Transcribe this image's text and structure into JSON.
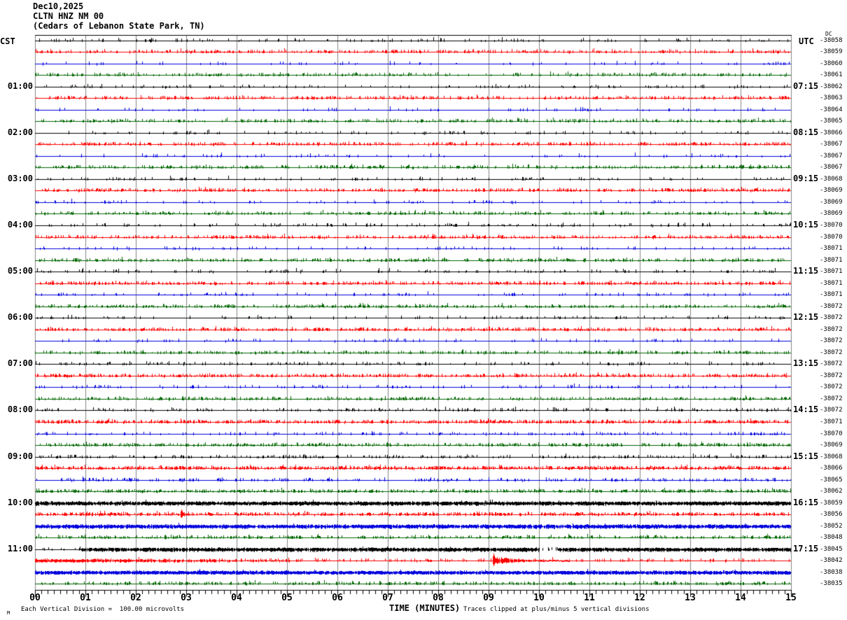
{
  "header": {
    "date": "Dec10,2025",
    "station": "CLTN HNZ NM 00",
    "location": "(Cedars of Lebanon State Park, TN)"
  },
  "left_axis": {
    "label": "CST"
  },
  "right_axis": {
    "label": "UTC",
    "dc_header": "DC"
  },
  "x_axis": {
    "label": "TIME (MINUTES)",
    "ticks": [
      "00",
      "01",
      "02",
      "03",
      "04",
      "05",
      "06",
      "07",
      "08",
      "09",
      "10",
      "11",
      "12",
      "13",
      "14",
      "15"
    ]
  },
  "footer": {
    "scale_note": "Each Vertical Division =  100.00 microvolts",
    "clip_note": "Traces clipped at plus/minus 5 vertical divisions",
    "corner_mark": "M"
  },
  "chart_data": {
    "type": "line",
    "subtype": "seismogram_helicorder",
    "title": "CLTN HNZ NM 00 (Cedars of Lebanon State Park, TN) Dec10,2025",
    "minutes_per_row": 15,
    "rows_total": 48,
    "grid": "vertical lines each minute",
    "left_hour_labels": [
      "01:00",
      "02:00",
      "03:00",
      "04:00",
      "05:00",
      "06:00",
      "07:00",
      "08:00",
      "09:00",
      "10:00",
      "11:00"
    ],
    "right_hour_labels": [
      "07:15",
      "08:15",
      "09:15",
      "10:15",
      "11:15",
      "12:15",
      "13:15",
      "14:15",
      "15:15",
      "16:15",
      "17:15"
    ],
    "colors": {
      "black": "#000000",
      "red": "#ff0000",
      "blue": "#0000dd",
      "green": "#006600",
      "grid": "#858585"
    },
    "rows": [
      {
        "cst": "00:00",
        "color": "black",
        "dc": "-38058",
        "noise": 0.1
      },
      {
        "cst": "00:15",
        "color": "red",
        "dc": "-38059",
        "noise": 0.3
      },
      {
        "cst": "00:30",
        "color": "blue",
        "dc": "-38060",
        "noise": 0.08
      },
      {
        "cst": "00:45",
        "color": "green",
        "dc": "-38061",
        "noise": 0.25
      },
      {
        "cst": "01:00",
        "color": "black",
        "dc": "-38062",
        "noise": 0.1
      },
      {
        "cst": "01:15",
        "color": "red",
        "dc": "-38063",
        "noise": 0.3
      },
      {
        "cst": "01:30",
        "color": "blue",
        "dc": "-38064",
        "noise": 0.08
      },
      {
        "cst": "01:45",
        "color": "green",
        "dc": "-38065",
        "noise": 0.26
      },
      {
        "cst": "02:00",
        "color": "black",
        "dc": "-38066",
        "noise": 0.1
      },
      {
        "cst": "02:15",
        "color": "red",
        "dc": "-38067",
        "noise": 0.3
      },
      {
        "cst": "02:30",
        "color": "blue",
        "dc": "-38067",
        "noise": 0.08
      },
      {
        "cst": "02:45",
        "color": "green",
        "dc": "-38067",
        "noise": 0.26
      },
      {
        "cst": "03:00",
        "color": "black",
        "dc": "-38068",
        "noise": 0.1
      },
      {
        "cst": "03:15",
        "color": "red",
        "dc": "-38069",
        "noise": 0.35
      },
      {
        "cst": "03:30",
        "color": "blue",
        "dc": "-38069",
        "noise": 0.08
      },
      {
        "cst": "03:45",
        "color": "green",
        "dc": "-38069",
        "noise": 0.26
      },
      {
        "cst": "04:00",
        "color": "black",
        "dc": "-38070",
        "noise": 0.12
      },
      {
        "cst": "04:15",
        "color": "red",
        "dc": "-38070",
        "noise": 0.32
      },
      {
        "cst": "04:30",
        "color": "blue",
        "dc": "-38071",
        "noise": 0.08
      },
      {
        "cst": "04:45",
        "color": "green",
        "dc": "-38071",
        "noise": 0.28
      },
      {
        "cst": "05:00",
        "color": "black",
        "dc": "-38071",
        "noise": 0.12
      },
      {
        "cst": "05:15",
        "color": "red",
        "dc": "-38071",
        "noise": 0.32
      },
      {
        "cst": "05:30",
        "color": "blue",
        "dc": "-38071",
        "noise": 0.1
      },
      {
        "cst": "05:45",
        "color": "green",
        "dc": "-38072",
        "noise": 0.28
      },
      {
        "cst": "06:00",
        "color": "black",
        "dc": "-38072",
        "noise": 0.12
      },
      {
        "cst": "06:15",
        "color": "red",
        "dc": "-38072",
        "noise": 0.35
      },
      {
        "cst": "06:30",
        "color": "blue",
        "dc": "-38072",
        "noise": 0.1
      },
      {
        "cst": "06:45",
        "color": "green",
        "dc": "-38072",
        "noise": 0.28
      },
      {
        "cst": "07:00",
        "color": "black",
        "dc": "-38072",
        "noise": 0.15
      },
      {
        "cst": "07:15",
        "color": "red",
        "dc": "-38072",
        "noise": 0.35
      },
      {
        "cst": "07:30",
        "color": "blue",
        "dc": "-38072",
        "noise": 0.1
      },
      {
        "cst": "07:45",
        "color": "green",
        "dc": "-38072",
        "noise": 0.3
      },
      {
        "cst": "08:00",
        "color": "black",
        "dc": "-38072",
        "noise": 0.15
      },
      {
        "cst": "08:15",
        "color": "red",
        "dc": "-38071",
        "noise": 0.45
      },
      {
        "cst": "08:30",
        "color": "blue",
        "dc": "-38070",
        "noise": 0.15
      },
      {
        "cst": "08:45",
        "color": "green",
        "dc": "-38069",
        "noise": 0.35
      },
      {
        "cst": "09:00",
        "color": "black",
        "dc": "-38068",
        "noise": 0.18
      },
      {
        "cst": "09:15",
        "color": "red",
        "dc": "-38066",
        "noise": 0.5
      },
      {
        "cst": "09:30",
        "color": "blue",
        "dc": "-38065",
        "noise": 0.2
      },
      {
        "cst": "09:45",
        "color": "green",
        "dc": "-38062",
        "noise": 0.4
      },
      {
        "cst": "10:00",
        "color": "black",
        "dc": "-38059",
        "noise": 0.2,
        "band": [
          [
            0,
            15,
            1.7
          ]
        ]
      },
      {
        "cst": "10:15",
        "color": "red",
        "dc": "-38056",
        "noise": 0.45
      },
      {
        "cst": "10:30",
        "color": "blue",
        "dc": "-38052",
        "noise": 0.2,
        "band": [
          [
            0,
            15,
            1.7
          ]
        ]
      },
      {
        "cst": "10:45",
        "color": "green",
        "dc": "-38048",
        "noise": 0.3
      },
      {
        "cst": "11:00",
        "color": "black",
        "dc": "-38045",
        "noise": 0.15,
        "band": [
          [
            0.9,
            10.0,
            1.7
          ],
          [
            10.38,
            15,
            1.7
          ]
        ],
        "line_segments": [
          [
            0,
            10.0
          ],
          [
            10.38,
            15
          ]
        ]
      },
      {
        "cst": "11:15",
        "color": "red",
        "dc": "-38042",
        "noise": 0.2,
        "fade_band": [
          0,
          5.2,
          1.5
        ]
      },
      {
        "cst": "11:30",
        "color": "blue",
        "dc": "-38038",
        "noise": 0.25,
        "band": [
          [
            0,
            15,
            1.6
          ]
        ]
      },
      {
        "cst": "11:45",
        "color": "green",
        "dc": "-38035",
        "noise": 0.28
      }
    ],
    "events": [
      {
        "row": 41,
        "minute": 2.9,
        "amp": 7,
        "coda_minutes": 0.18,
        "note": "small spike on 10:15 CST red trace"
      },
      {
        "row": 45,
        "minute": 9.1,
        "amp": 10,
        "coda_minutes": 1.5,
        "note": "event with decaying coda on 11:15 CST red trace"
      }
    ]
  }
}
